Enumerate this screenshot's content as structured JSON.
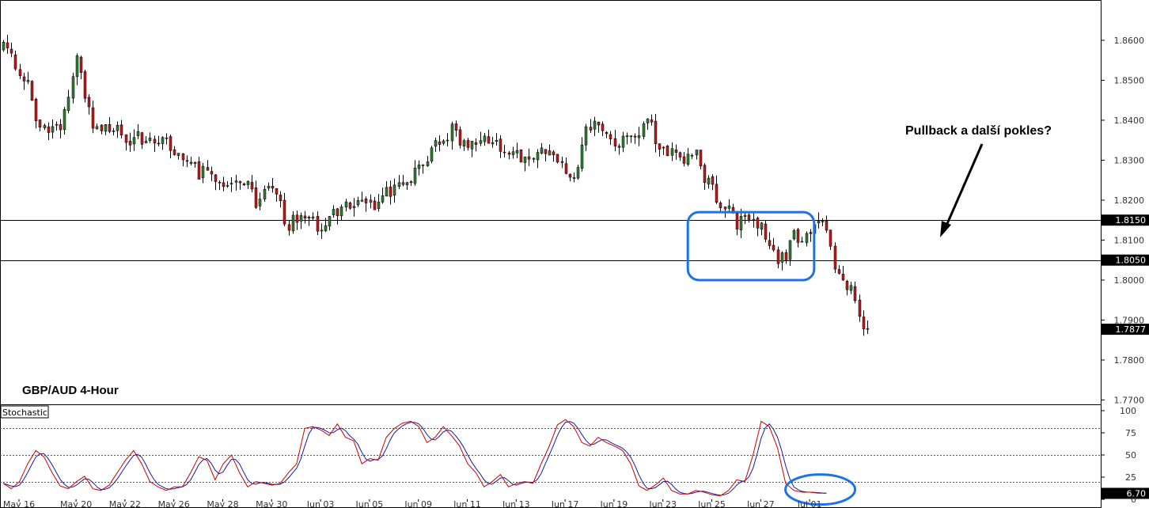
{
  "chart_data": {
    "type": "candlestick",
    "title": "GBP/AUD 4-Hour",
    "annotation": "Pullback a další pokles?",
    "colors": {
      "bull": "#2e7d32",
      "bear": "#b71c1c",
      "wick": "#000000",
      "highlight": "#1a73e8",
      "stoch_k": "#cc0000",
      "stoch_d": "#1a1aa6"
    },
    "price_axis": {
      "ticks": [
        "1.8600",
        "1.8500",
        "1.8400",
        "1.8300",
        "1.8200",
        "1.8100",
        "1.8000",
        "1.7900",
        "1.7800",
        "1.7700"
      ],
      "range": [
        1.7695,
        1.8685
      ]
    },
    "levels": [
      {
        "value": 1.815,
        "label": "1.8150"
      },
      {
        "value": 1.805,
        "label": "1.8050"
      }
    ],
    "last_price": {
      "value": 1.7877,
      "label": "1.7877"
    },
    "highlight_zone": {
      "top": 1.817,
      "bottom": 1.8,
      "start_index": 168,
      "end_index": 199
    },
    "anchors": [
      [
        0,
        1.858
      ],
      [
        2,
        1.856
      ],
      [
        4,
        1.852
      ],
      [
        6,
        1.85
      ],
      [
        8,
        1.84
      ],
      [
        10,
        1.838
      ],
      [
        14,
        1.839
      ],
      [
        16,
        1.846
      ],
      [
        18,
        1.855
      ],
      [
        20,
        1.845
      ],
      [
        22,
        1.84
      ],
      [
        26,
        1.838
      ],
      [
        30,
        1.836
      ],
      [
        34,
        1.835
      ],
      [
        38,
        1.836
      ],
      [
        42,
        1.831
      ],
      [
        46,
        1.828
      ],
      [
        50,
        1.826
      ],
      [
        55,
        1.822
      ],
      [
        58,
        1.826
      ],
      [
        62,
        1.82
      ],
      [
        66,
        1.822
      ],
      [
        70,
        1.814
      ],
      [
        74,
        1.815
      ],
      [
        78,
        1.814
      ],
      [
        82,
        1.818
      ],
      [
        86,
        1.82
      ],
      [
        90,
        1.818
      ],
      [
        94,
        1.822
      ],
      [
        98,
        1.824
      ],
      [
        102,
        1.828
      ],
      [
        106,
        1.833
      ],
      [
        110,
        1.837
      ],
      [
        114,
        1.834
      ],
      [
        118,
        1.837
      ],
      [
        122,
        1.833
      ],
      [
        126,
        1.831
      ],
      [
        130,
        1.832
      ],
      [
        134,
        1.832
      ],
      [
        138,
        1.827
      ],
      [
        140,
        1.825
      ],
      [
        143,
        1.837
      ],
      [
        146,
        1.84
      ],
      [
        150,
        1.834
      ],
      [
        154,
        1.834
      ],
      [
        158,
        1.84
      ],
      [
        162,
        1.832
      ],
      [
        166,
        1.83
      ],
      [
        170,
        1.833
      ],
      [
        172,
        1.825
      ],
      [
        176,
        1.82
      ],
      [
        180,
        1.814
      ],
      [
        183,
        1.815
      ],
      [
        187,
        1.812
      ],
      [
        190,
        1.806
      ],
      [
        192,
        1.806
      ],
      [
        194,
        1.812
      ],
      [
        196,
        1.808
      ],
      [
        198,
        1.813
      ],
      [
        200,
        1.816
      ],
      [
        202,
        1.812
      ],
      [
        204,
        1.804
      ],
      [
        206,
        1.801
      ],
      [
        208,
        1.798
      ],
      [
        210,
        1.79
      ],
      [
        212,
        1.7877
      ]
    ],
    "x_axis": {
      "labels": [
        {
          "label": "May 16",
          "index": 0
        },
        {
          "label": "May 20",
          "index": 14
        },
        {
          "label": "May 22",
          "index": 26
        },
        {
          "label": "May 26",
          "index": 38
        },
        {
          "label": "May 28",
          "index": 50
        },
        {
          "label": "May 30",
          "index": 62
        },
        {
          "label": "Jun 03",
          "index": 74
        },
        {
          "label": "Jun 05",
          "index": 86
        },
        {
          "label": "Jun 09",
          "index": 98
        },
        {
          "label": "Jun 11",
          "index": 110
        },
        {
          "label": "Jun 13",
          "index": 122
        },
        {
          "label": "Jun 17",
          "index": 134
        },
        {
          "label": "Jun 19",
          "index": 146
        },
        {
          "label": "Jun 23",
          "index": 158
        },
        {
          "label": "Jun 25",
          "index": 170
        },
        {
          "label": "Jun 27",
          "index": 182
        },
        {
          "label": "Jul 01",
          "index": 194
        }
      ]
    },
    "stochastic": {
      "label": "Stochastic",
      "ticks": [
        "100",
        "75",
        "50",
        "25",
        "0"
      ],
      "levels": [
        80,
        50,
        20
      ],
      "last": {
        "value": 6.7,
        "label": "6.70"
      },
      "k_anchors": [
        [
          0,
          18
        ],
        [
          2,
          12
        ],
        [
          4,
          20
        ],
        [
          6,
          40
        ],
        [
          8,
          55
        ],
        [
          10,
          48
        ],
        [
          12,
          30
        ],
        [
          14,
          15
        ],
        [
          16,
          12
        ],
        [
          18,
          20
        ],
        [
          20,
          26
        ],
        [
          22,
          12
        ],
        [
          24,
          10
        ],
        [
          26,
          16
        ],
        [
          28,
          30
        ],
        [
          30,
          44
        ],
        [
          32,
          55
        ],
        [
          34,
          40
        ],
        [
          36,
          20
        ],
        [
          38,
          14
        ],
        [
          40,
          10
        ],
        [
          42,
          14
        ],
        [
          44,
          14
        ],
        [
          46,
          30
        ],
        [
          48,
          48
        ],
        [
          50,
          44
        ],
        [
          52,
          22
        ],
        [
          54,
          40
        ],
        [
          56,
          50
        ],
        [
          58,
          30
        ],
        [
          60,
          14
        ],
        [
          62,
          20
        ],
        [
          64,
          18
        ],
        [
          66,
          16
        ],
        [
          68,
          18
        ],
        [
          70,
          30
        ],
        [
          72,
          40
        ],
        [
          74,
          80
        ],
        [
          76,
          82
        ],
        [
          78,
          78
        ],
        [
          80,
          72
        ],
        [
          82,
          85
        ],
        [
          84,
          70
        ],
        [
          86,
          66
        ],
        [
          88,
          40
        ],
        [
          90,
          46
        ],
        [
          92,
          44
        ],
        [
          94,
          70
        ],
        [
          96,
          80
        ],
        [
          98,
          86
        ],
        [
          100,
          88
        ],
        [
          102,
          82
        ],
        [
          104,
          64
        ],
        [
          106,
          70
        ],
        [
          108,
          82
        ],
        [
          110,
          72
        ],
        [
          112,
          60
        ],
        [
          114,
          40
        ],
        [
          116,
          30
        ],
        [
          118,
          14
        ],
        [
          120,
          20
        ],
        [
          122,
          28
        ],
        [
          124,
          14
        ],
        [
          126,
          18
        ],
        [
          128,
          20
        ],
        [
          130,
          18
        ],
        [
          132,
          40
        ],
        [
          134,
          60
        ],
        [
          136,
          84
        ],
        [
          138,
          90
        ],
        [
          140,
          82
        ],
        [
          142,
          64
        ],
        [
          144,
          60
        ],
        [
          146,
          70
        ],
        [
          148,
          64
        ],
        [
          150,
          60
        ],
        [
          152,
          55
        ],
        [
          154,
          40
        ],
        [
          156,
          15
        ],
        [
          158,
          10
        ],
        [
          160,
          16
        ],
        [
          162,
          24
        ],
        [
          164,
          10
        ],
        [
          166,
          6
        ],
        [
          168,
          6
        ],
        [
          170,
          10
        ],
        [
          172,
          8
        ],
        [
          174,
          5
        ],
        [
          176,
          4
        ],
        [
          178,
          10
        ],
        [
          180,
          22
        ],
        [
          182,
          20
        ],
        [
          184,
          50
        ],
        [
          186,
          88
        ],
        [
          188,
          82
        ],
        [
          190,
          58
        ],
        [
          192,
          18
        ],
        [
          194,
          10
        ],
        [
          196,
          8
        ],
        [
          198,
          8
        ],
        [
          200,
          7
        ],
        [
          202,
          6.7
        ]
      ]
    }
  }
}
